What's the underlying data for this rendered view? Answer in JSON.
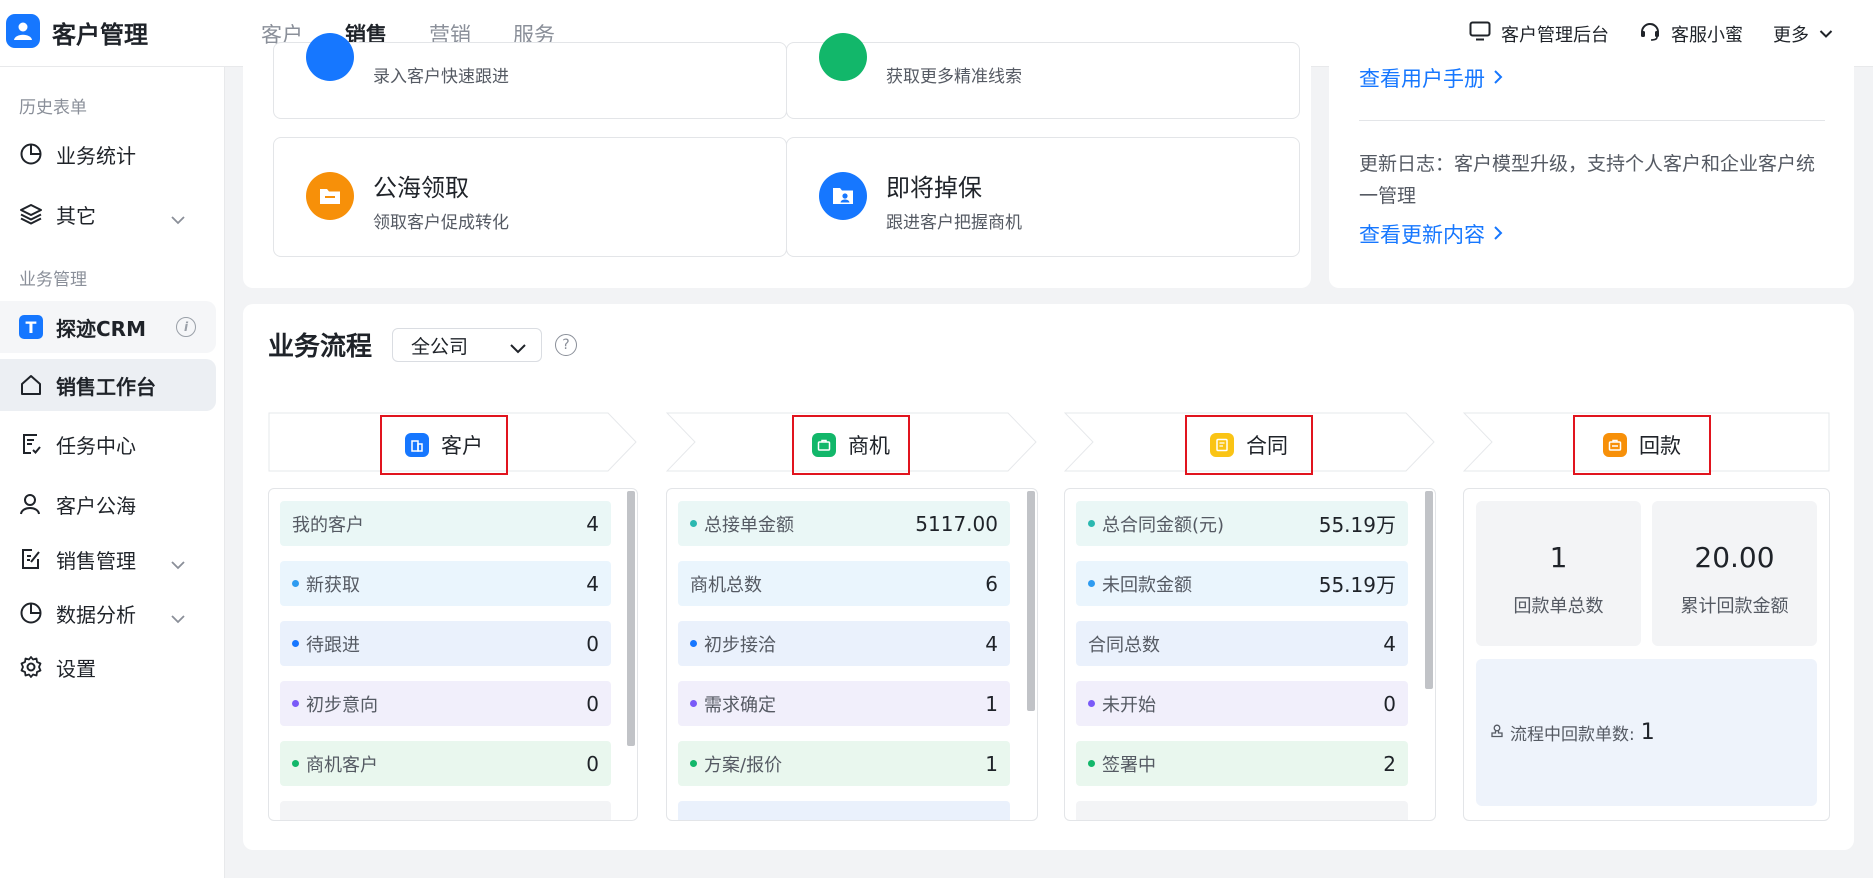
{
  "app": {
    "title": "客户管理"
  },
  "nav": {
    "tabs": [
      {
        "label": "客户"
      },
      {
        "label": "销售"
      },
      {
        "label": "营销"
      },
      {
        "label": "服务"
      }
    ]
  },
  "top_right": {
    "admin": "客户管理后台",
    "service": "客服小蜜",
    "more": "更多"
  },
  "sidebar": {
    "section_history": "历史表单",
    "biz_stats": "业务统计",
    "other": "其它",
    "section_biz": "业务管理",
    "crm": "探迹CRM",
    "sales_workbench": "销售工作台",
    "task_center": "任务中心",
    "customer_pool": "客户公海",
    "sales_mgmt": "销售管理",
    "data_analysis": "数据分析",
    "settings": "设置"
  },
  "quick": {
    "card1_desc": "录入客户快速跟进",
    "card2_desc": "获取更多精准线索",
    "card3_title": "公海领取",
    "card3_desc": "领取客户促成转化",
    "card4_title": "即将掉保",
    "card4_desc": "跟进客户把握商机"
  },
  "info": {
    "manual_link": "查看用户手册",
    "update_log": "更新日志：客户模型升级，支持个人客户和企业客户统一管理",
    "update_link": "查看更新内容"
  },
  "flow": {
    "title": "业务流程",
    "company": "全公司",
    "help": "?",
    "stages": [
      {
        "label": "客户"
      },
      {
        "label": "商机"
      },
      {
        "label": "合同"
      },
      {
        "label": "回款"
      }
    ],
    "customer_rows": [
      {
        "label": "我的客户",
        "value": "4"
      },
      {
        "label": "新获取",
        "value": "4"
      },
      {
        "label": "待跟进",
        "value": "0"
      },
      {
        "label": "初步意向",
        "value": "0"
      },
      {
        "label": "商机客户",
        "value": "0"
      }
    ],
    "opportunity_rows": [
      {
        "label": "总接单金额",
        "value": "5117.00"
      },
      {
        "label": "商机总数",
        "value": "6"
      },
      {
        "label": "初步接洽",
        "value": "4"
      },
      {
        "label": "需求确定",
        "value": "1"
      },
      {
        "label": "方案/报价",
        "value": "1"
      }
    ],
    "contract_rows": [
      {
        "label": "总合同金额(元)",
        "value": "55.19万"
      },
      {
        "label": "未回款金额",
        "value": "55.19万"
      },
      {
        "label": "合同总数",
        "value": "4"
      },
      {
        "label": "未开始",
        "value": "0"
      },
      {
        "label": "签署中",
        "value": "2"
      }
    ],
    "payment": {
      "count_value": "1",
      "count_label": "回款单总数",
      "amount_value": "20.00",
      "amount_label": "累计回款金额",
      "in_flow_label": "流程中回款单数:",
      "in_flow_value": "1"
    }
  },
  "colors": {
    "brand": "#1677ff",
    "green": "#12b76a",
    "yellow": "#fac415",
    "orange": "#f79009",
    "highlight_border": "#e1141e"
  }
}
